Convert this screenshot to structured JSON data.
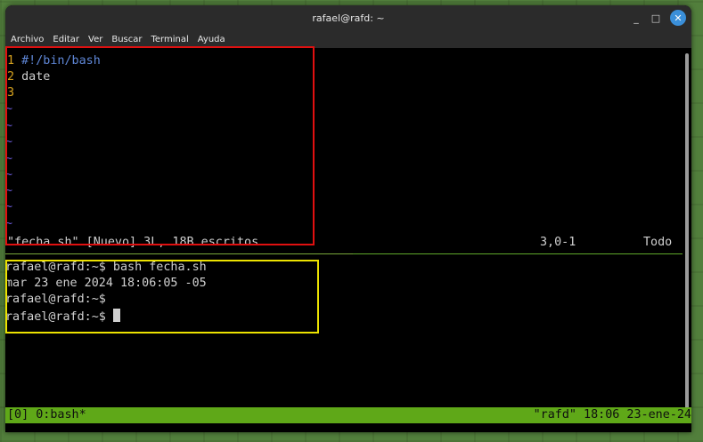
{
  "window": {
    "title": "rafael@rafd: ~",
    "controls": {
      "minimize": "_",
      "maximize": "□",
      "close": "✕"
    }
  },
  "menu": [
    "Archivo",
    "Editar",
    "Ver",
    "Buscar",
    "Terminal",
    "Ayuda"
  ],
  "vim": {
    "lines": [
      {
        "num": "1",
        "text": "#!/bin/bash"
      },
      {
        "num": "2",
        "text": "date"
      },
      {
        "num": "3",
        "text": ""
      }
    ],
    "tilde": "~",
    "tilde_count": 8,
    "status": "\"fecha.sh\" [Nuevo] 3L, 18B escritos",
    "position": "3,0-1",
    "scroll": "Todo"
  },
  "shell": {
    "lines": [
      "rafael@rafd:~$ bash fecha.sh",
      "mar 23 ene 2024 18:06:05 -05",
      "rafael@rafd:~$",
      "rafael@rafd:~$ "
    ]
  },
  "tmux": {
    "left": "[0] 0:bash*",
    "right": "\"rafd\" 18:06 23-ene-24"
  },
  "colors": {
    "highlight_vim": "#e01010",
    "highlight_shell": "#ece200",
    "tmux_bar": "#5fa818",
    "line_numbers": "#d7a31f",
    "shebang": "#5f87d7"
  }
}
